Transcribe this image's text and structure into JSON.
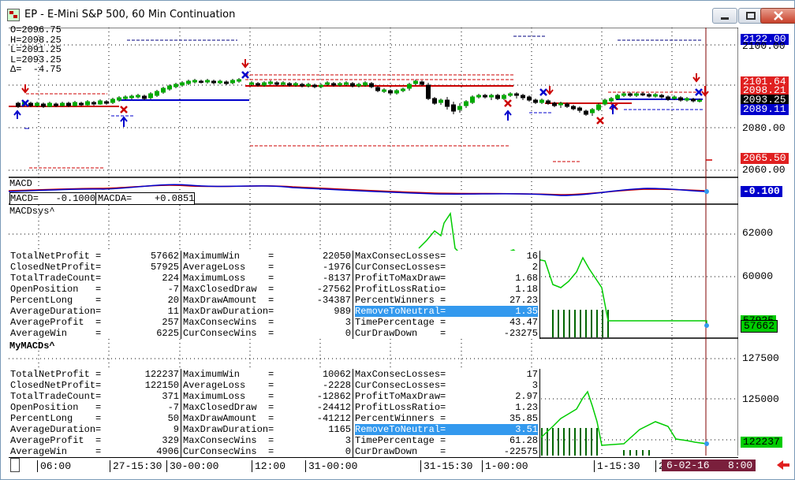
{
  "window": {
    "title": "EP - E-Mini S&P 500, 60 Min Continuation",
    "buttons": [
      "minimize",
      "restore",
      "close"
    ]
  },
  "ohlc": {
    "open": "O=2096.75",
    "high": "H=2098.25",
    "low": "L=2091.25",
    "last": "L=2093.25",
    "delta": "Δ=  -4.75"
  },
  "price_axis": {
    "ticks": [
      "2100.00",
      "2080.00",
      "2060.00"
    ],
    "tags": [
      {
        "text": "2122.00",
        "bg": "#0000cc",
        "fg": "#ffffff"
      },
      {
        "text": "2101.64",
        "bg": "#e02020",
        "fg": "#ffffff"
      },
      {
        "text": "2098.21",
        "bg": "#e02020",
        "fg": "#ffffff"
      },
      {
        "text": "2093.25",
        "bg": "#000000",
        "fg": "#ffffff"
      },
      {
        "text": "2089.11",
        "bg": "#0000cc",
        "fg": "#ffffff"
      },
      {
        "text": "2065.50",
        "bg": "#e02020",
        "fg": "#ffffff"
      }
    ]
  },
  "macd_pane": {
    "label": "MACD",
    "readout_macd": "MACD=   -0.1000",
    "readout_macda": "MACDA=    +0.0851",
    "axis_tag": "-0.100"
  },
  "pane1": {
    "label": "MACDsys^",
    "axis_ticks": [
      "62000",
      "60000"
    ],
    "axis_tags": [
      "57925",
      "57662"
    ],
    "stats": {
      "col1": [
        [
          "TotalNetProfit =",
          "57662"
        ],
        [
          "ClosedNetProfit=",
          "57925"
        ],
        [
          "TotalTradeCount=",
          "224"
        ],
        [
          "OpenPosition   =",
          "-7"
        ],
        [
          "PercentLong    =",
          "20"
        ],
        [
          "AverageDuration=",
          "11"
        ],
        [
          "AverageProfit  =",
          "257"
        ],
        [
          "AverageWin     =",
          "6225"
        ]
      ],
      "col2": [
        [
          "MaximumWin     =",
          "22050"
        ],
        [
          "AverageLoss    =",
          "-1976"
        ],
        [
          "MaximumLoss    =",
          "-8137"
        ],
        [
          "MaxClosedDraw  =",
          "-27562"
        ],
        [
          "MaxDrawAmount  =",
          "-34387"
        ],
        [
          "MaxDrawDuration=",
          "989"
        ],
        [
          "MaxConsecWins  =",
          "3"
        ],
        [
          "CurConsecWins  =",
          "0"
        ]
      ],
      "col3": [
        [
          "MaxConsecLosses=",
          "16"
        ],
        [
          "CurConsecLosses=",
          "2"
        ],
        [
          "ProfitToMaxDraw=",
          "1.68"
        ],
        [
          "ProfitLossRatio=",
          "1.18"
        ],
        [
          "PercentWinners =",
          "27.23"
        ],
        [
          "RemoveToNeutral=",
          "1.35"
        ],
        [
          "TimePercentage =",
          "43.47"
        ],
        [
          "CurDrawDown    =",
          "-23275"
        ]
      ]
    }
  },
  "pane2": {
    "label": "MyMACDs^",
    "axis_ticks": [
      "127500",
      "125000"
    ],
    "axis_tags": [
      "122237"
    ],
    "stats": {
      "col1": [
        [
          "TotalNetProfit =",
          "122237"
        ],
        [
          "ClosedNetProfit=",
          "122150"
        ],
        [
          "TotalTradeCount=",
          "371"
        ],
        [
          "OpenPosition   =",
          "-7"
        ],
        [
          "PercentLong    =",
          "50"
        ],
        [
          "AverageDuration=",
          "9"
        ],
        [
          "AverageProfit  =",
          "329"
        ],
        [
          "AverageWin     =",
          "4906"
        ]
      ],
      "col2": [
        [
          "MaximumWin     =",
          "10062"
        ],
        [
          "AverageLoss    =",
          "-2228"
        ],
        [
          "MaximumLoss    =",
          "-12862"
        ],
        [
          "MaxClosedDraw  =",
          "-24412"
        ],
        [
          "MaxDrawAmount  =",
          "-41212"
        ],
        [
          "MaxDrawDuration=",
          "1165"
        ],
        [
          "MaxConsecWins  =",
          "3"
        ],
        [
          "CurConsecWins  =",
          "0"
        ]
      ],
      "col3": [
        [
          "MaxConsecLosses=",
          "17"
        ],
        [
          "CurConsecLosses=",
          "3"
        ],
        [
          "ProfitToMaxDraw=",
          "2.97"
        ],
        [
          "ProfitLossRatio=",
          "1.23"
        ],
        [
          "PercentWinners =",
          "35.85"
        ],
        [
          "RemoveToNeutral=",
          "3.51"
        ],
        [
          "TimePercentage =",
          "61.28"
        ],
        [
          "CurDrawDown    =",
          "-22575"
        ]
      ]
    }
  },
  "time_axis": {
    "labels": [
      "06:00",
      "27-15:30",
      "30-00:00",
      "12:00",
      "31-00:00",
      "31-15:30",
      "1-00:00",
      "1-15:30",
      "2"
    ],
    "current_date": "6-02-16   8:00"
  },
  "colors": {
    "up_candle": "#00aa00",
    "down_candle": "#000000",
    "resistance": "#cc0000",
    "support": "#0000cc",
    "equity_line": "#00cc00"
  }
}
